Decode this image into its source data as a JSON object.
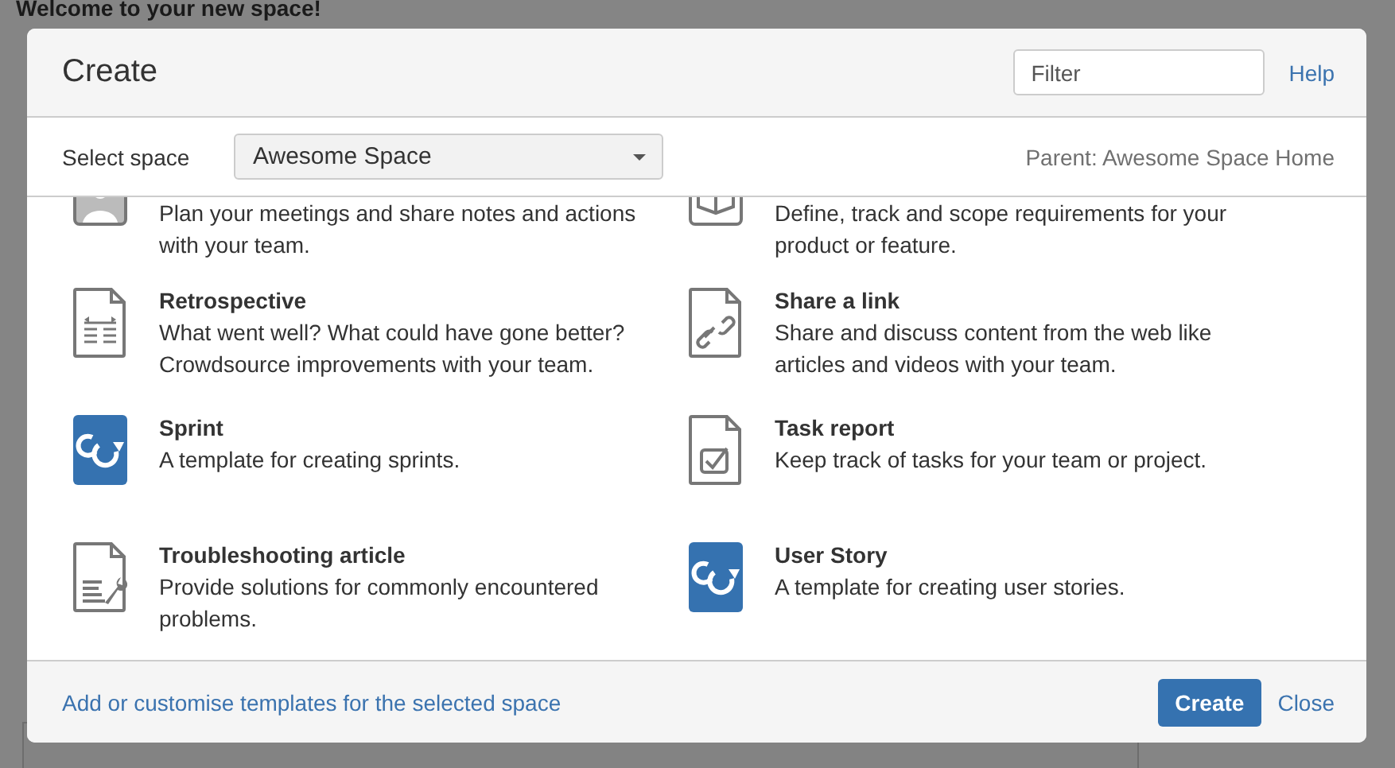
{
  "background_page": {
    "heading": "Welcome to your new space!"
  },
  "dialog": {
    "title": "Create",
    "filter_placeholder": "Filter",
    "help_link": "Help",
    "space_label": "Select space",
    "space_value": "Awesome Space",
    "parent_text": "Parent: Awesome Space Home",
    "templates": [
      {
        "kind": "people",
        "description": "Plan your meetings and share notes and actions with your team."
      },
      {
        "kind": "book",
        "description": "Define, track and scope requirements for your product or feature."
      },
      {
        "kind": "retro",
        "title": "Retrospective",
        "description": "What went well? What could have gone better? Crowdsource improvements with your team."
      },
      {
        "kind": "link",
        "title": "Share a link",
        "description": "Share and discuss content from the web like articles and videos with your team."
      },
      {
        "kind": "sprint",
        "title": "Sprint",
        "description": "A template for creating sprints."
      },
      {
        "kind": "task",
        "title": "Task report",
        "description": "Keep track of tasks for your team or project."
      },
      {
        "kind": "troubleshoot",
        "title": "Troubleshooting article",
        "description": "Provide solutions for commonly encountered problems."
      },
      {
        "kind": "story",
        "title": "User Story",
        "description": "A template for creating user stories."
      }
    ],
    "footer_link": "Add or customise templates for the selected space",
    "buttons": [
      {
        "kind": "primary",
        "label": "Create"
      },
      {
        "kind": "link",
        "label": "Close"
      }
    ]
  }
}
